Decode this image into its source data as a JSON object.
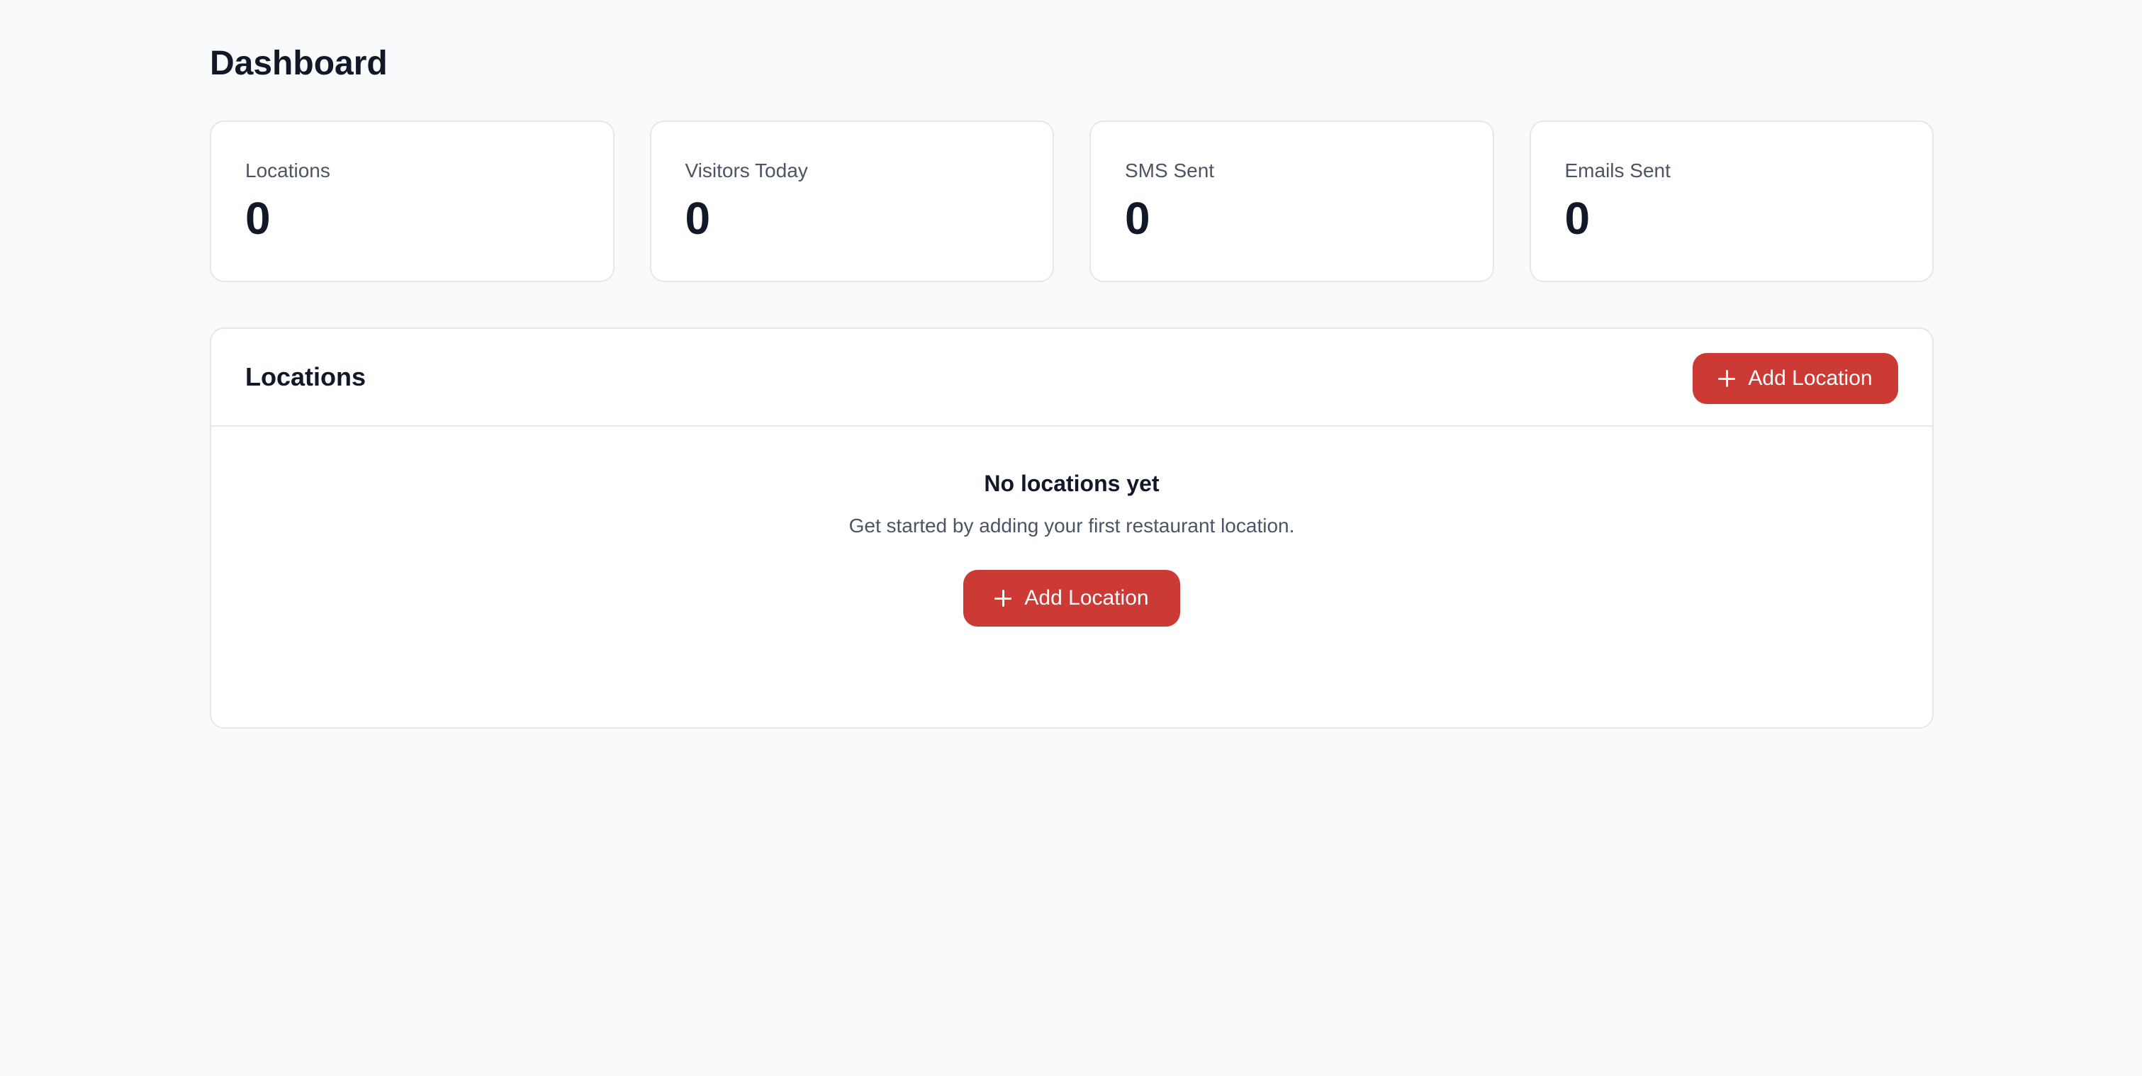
{
  "header": {
    "title": "Dashboard"
  },
  "stats": [
    {
      "label": "Locations",
      "value": "0"
    },
    {
      "label": "Visitors Today",
      "value": "0"
    },
    {
      "label": "SMS Sent",
      "value": "0"
    },
    {
      "label": "Emails Sent",
      "value": "0"
    }
  ],
  "locations_panel": {
    "title": "Locations",
    "add_button_label": "Add Location",
    "add_button_icon": "plus-icon",
    "empty_state": {
      "title": "No locations yet",
      "description": "Get started by adding your first restaurant location.",
      "button_label": "Add Location",
      "button_icon": "plus-icon"
    }
  },
  "colors": {
    "accent": "#cb3a35",
    "background": "#f9fafb",
    "card": "#ffffff",
    "border": "#e5e7eb"
  }
}
